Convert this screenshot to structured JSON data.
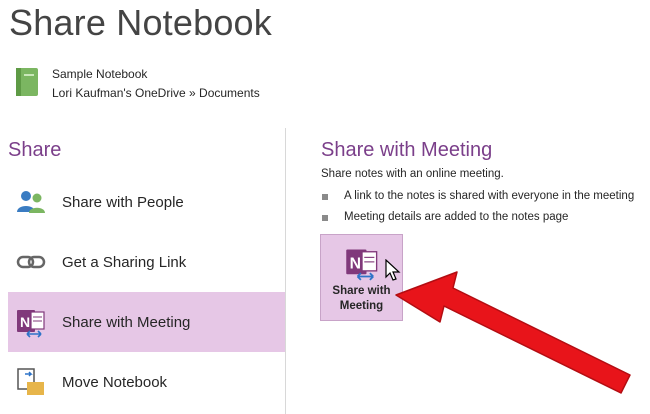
{
  "page": {
    "title": "Share Notebook"
  },
  "notebook": {
    "name": "Sample Notebook",
    "location": "Lori Kaufman's OneDrive » Documents",
    "icon": "notebook-icon",
    "icon_color": "#7bb661"
  },
  "share": {
    "heading": "Share",
    "items": [
      {
        "label": "Share with People",
        "icon": "people-icon"
      },
      {
        "label": "Get a Sharing Link",
        "icon": "link-icon"
      },
      {
        "label": "Share with Meeting",
        "icon": "onenote-meeting-icon",
        "selected": true
      },
      {
        "label": "Move Notebook",
        "icon": "move-notebook-icon"
      }
    ]
  },
  "panel": {
    "heading": "Share with Meeting",
    "description": "Share notes with an online meeting.",
    "bullets": [
      "A link to the notes is shared with everyone in the meeting",
      "Meeting details are added to the notes page"
    ],
    "button_line1": "Share with",
    "button_line2": "Meeting"
  },
  "colors": {
    "accent": "#7b3f8a",
    "selected_bg": "#e6c7e6",
    "onenote_purple": "#80397b",
    "annotation_arrow": "#e8141a"
  }
}
